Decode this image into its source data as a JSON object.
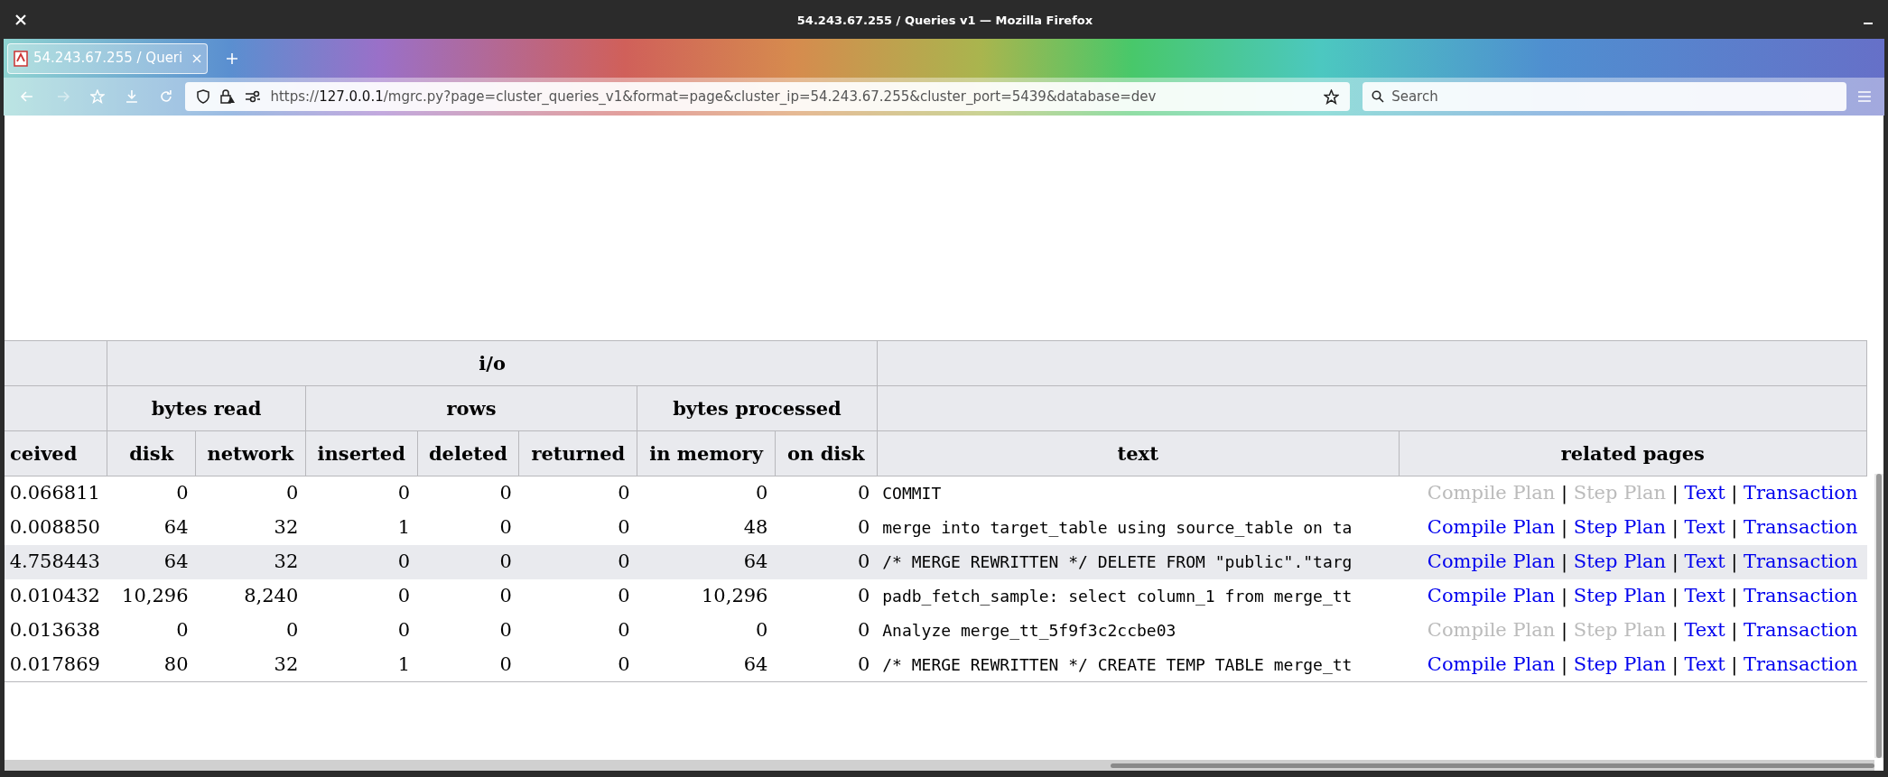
{
  "window": {
    "title": "54.243.67.255 / Queries v1 — Mozilla Firefox"
  },
  "tabs": [
    {
      "label": "54.243.67.255 / Queri",
      "selected": true
    }
  ],
  "address_bar": {
    "url_prefix": "https://",
    "url_host": "127.0.0.1",
    "url_rest": "/mgrc.py?page=cluster_queries_v1&format=page&cluster_ip=54.243.67.255&cluster_port=5439&database=dev"
  },
  "search": {
    "placeholder": "Search"
  },
  "table": {
    "group_header": "i/o",
    "sub_headers": [
      "bytes read",
      "rows",
      "bytes processed"
    ],
    "columns": [
      "ceived",
      "disk",
      "network",
      "inserted",
      "deleted",
      "returned",
      "in memory",
      "on disk",
      "text",
      "related pages"
    ],
    "rows": [
      {
        "highlighted": false,
        "cells": [
          "0.066811",
          "0",
          "0",
          "0",
          "0",
          "0",
          "0",
          "0",
          "COMMIT"
        ],
        "links": [
          {
            "label": "Compile Plan",
            "enabled": false
          },
          {
            "separator": "|",
            "label": "Step Plan",
            "enabled": false
          },
          {
            "separator": "|",
            "label": "Text",
            "enabled": true
          },
          {
            "separator": "|",
            "label": "Transaction",
            "enabled": true
          }
        ]
      },
      {
        "highlighted": false,
        "cells": [
          "0.008850",
          "64",
          "32",
          "1",
          "0",
          "0",
          "48",
          "0",
          "merge into target_table using source_table on ta"
        ],
        "links": [
          {
            "label": "Compile Plan",
            "enabled": true
          },
          {
            "separator": "|",
            "label": "Step Plan",
            "enabled": true
          },
          {
            "separator": "|",
            "label": "Text",
            "enabled": true
          },
          {
            "separator": "|",
            "label": "Transaction",
            "enabled": true
          }
        ]
      },
      {
        "highlighted": true,
        "cells": [
          "4.758443",
          "64",
          "32",
          "0",
          "0",
          "0",
          "64",
          "0",
          "/* MERGE REWRITTEN */ DELETE FROM \"public\".\"targ"
        ],
        "links": [
          {
            "label": "Compile Plan",
            "enabled": true
          },
          {
            "separator": "|",
            "label": "Step Plan",
            "enabled": true
          },
          {
            "separator": "|",
            "label": "Text",
            "enabled": true
          },
          {
            "separator": "|",
            "label": "Transaction",
            "enabled": true
          }
        ]
      },
      {
        "highlighted": false,
        "cells": [
          "0.010432",
          "10,296",
          "8,240",
          "0",
          "0",
          "0",
          "10,296",
          "0",
          "padb_fetch_sample: select column_1 from merge_tt"
        ],
        "links": [
          {
            "label": "Compile Plan",
            "enabled": true
          },
          {
            "separator": "|",
            "label": "Step Plan",
            "enabled": true
          },
          {
            "separator": "|",
            "label": "Text",
            "enabled": true
          },
          {
            "separator": "|",
            "label": "Transaction",
            "enabled": true
          }
        ]
      },
      {
        "highlighted": false,
        "cells": [
          "0.013638",
          "0",
          "0",
          "0",
          "0",
          "0",
          "0",
          "0",
          "Analyze merge_tt_5f9f3c2ccbe03"
        ],
        "links": [
          {
            "label": "Compile Plan",
            "enabled": false
          },
          {
            "separator": "|",
            "label": "Step Plan",
            "enabled": false
          },
          {
            "separator": "|",
            "label": "Text",
            "enabled": true
          },
          {
            "separator": "|",
            "label": "Transaction",
            "enabled": true
          }
        ]
      },
      {
        "highlighted": false,
        "cells": [
          "0.017869",
          "80",
          "32",
          "1",
          "0",
          "0",
          "64",
          "0",
          "/* MERGE REWRITTEN */ CREATE TEMP TABLE merge_tt"
        ],
        "links": [
          {
            "label": "Compile Plan",
            "enabled": true
          },
          {
            "separator": "|",
            "label": "Step Plan",
            "enabled": true
          },
          {
            "separator": "|",
            "label": "Text",
            "enabled": true
          },
          {
            "separator": "|",
            "label": "Transaction",
            "enabled": true
          }
        ]
      }
    ]
  }
}
